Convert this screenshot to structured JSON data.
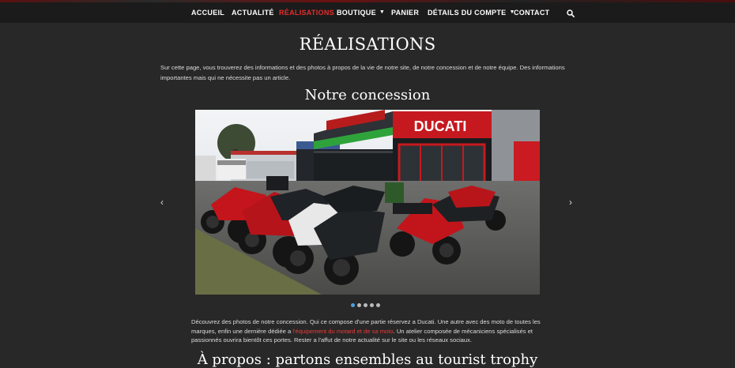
{
  "nav": {
    "items": [
      {
        "label": "ACCUEIL"
      },
      {
        "label": "ACTUALITÉ"
      },
      {
        "label": "RÉALISATIONS",
        "active": true
      },
      {
        "label": "BOUTIQUE",
        "has_dropdown": true
      },
      {
        "label": "PANIER"
      },
      {
        "label": "DÉTAILS DU COMPTE",
        "has_dropdown": true
      },
      {
        "label": "CONTACT"
      }
    ],
    "search_icon": "search-icon"
  },
  "page": {
    "title": "RÉALISATIONS",
    "intro": "Sur cette page, vous trouverez des informations et des photos à propos de la vie de notre site, de notre concession et de notre équipe. Des informations importantes mais qui ne nécessite pas un article.",
    "section_title": "Notre concession",
    "slider": {
      "dealership_sign": "DUCATI",
      "dot_count": 5,
      "active_dot": 1
    },
    "description": {
      "part1": "Découvrez des photos de notre concession. Qui ce compose d'une partie réservez a Ducati. Une autre avec des moto de toutes les marques, enfin une dernière dédiée a ",
      "link": "l'équipement du motard et de sa moto",
      "part2": ". Un atelier composée de mécaniciens spécialisés et passionnés ouvrira bientôt ces portes. Rester a l'affut de notre actualité sur le site ou les réseaux sociaux."
    },
    "next_title": "À propos : partons ensembles au tourist trophy"
  },
  "colors": {
    "background": "#282828",
    "navbar": "#1b1b1b",
    "accent": "#e52d2d",
    "dot_active": "#4aa3df"
  }
}
